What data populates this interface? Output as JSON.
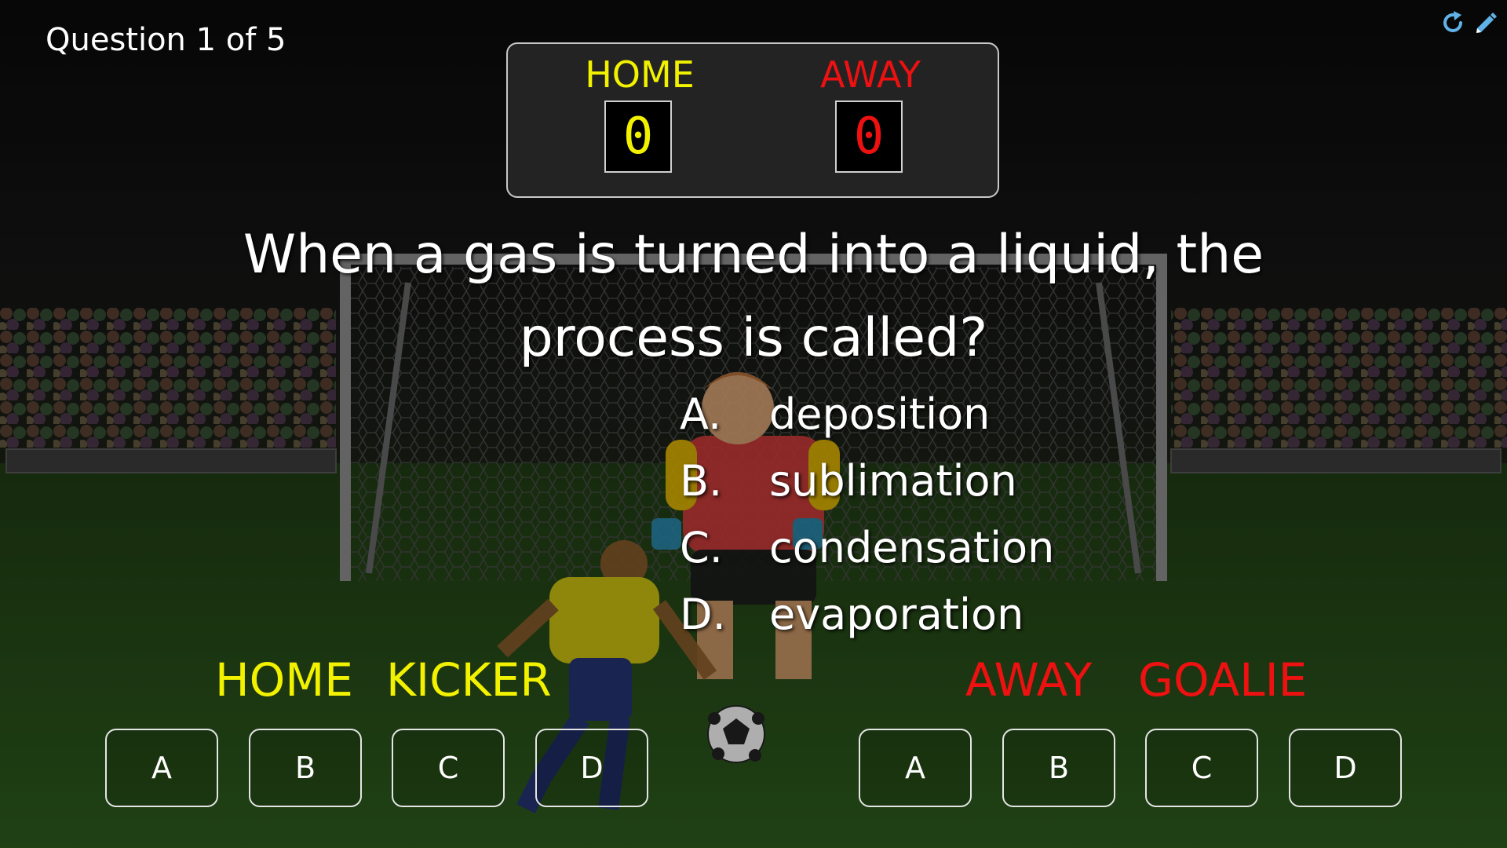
{
  "header": {
    "question_counter": "Question 1 of 5"
  },
  "toolbar": {
    "icons": [
      "refresh-icon",
      "pencil-icon"
    ]
  },
  "scoreboard": {
    "home_label": "HOME",
    "away_label": "AWAY",
    "home_score": "0",
    "away_score": "0",
    "home_color": "#f2f200",
    "away_color": "#ee1111"
  },
  "question": {
    "line1": "When a gas is turned into a liquid, the",
    "line2": "process is called?"
  },
  "choices": [
    {
      "letter": "A.",
      "text": "deposition"
    },
    {
      "letter": "B.",
      "text": "sublimation"
    },
    {
      "letter": "C.",
      "text": "condensation"
    },
    {
      "letter": "D.",
      "text": "evaporation"
    }
  ],
  "home_panel": {
    "team": "HOME",
    "role": "KICKER",
    "buttons": [
      "A",
      "B",
      "C",
      "D"
    ]
  },
  "away_panel": {
    "team": "AWAY",
    "role": "GOALIE",
    "buttons": [
      "A",
      "B",
      "C",
      "D"
    ]
  },
  "colors": {
    "home": "#f2f200",
    "away": "#ee1111"
  }
}
